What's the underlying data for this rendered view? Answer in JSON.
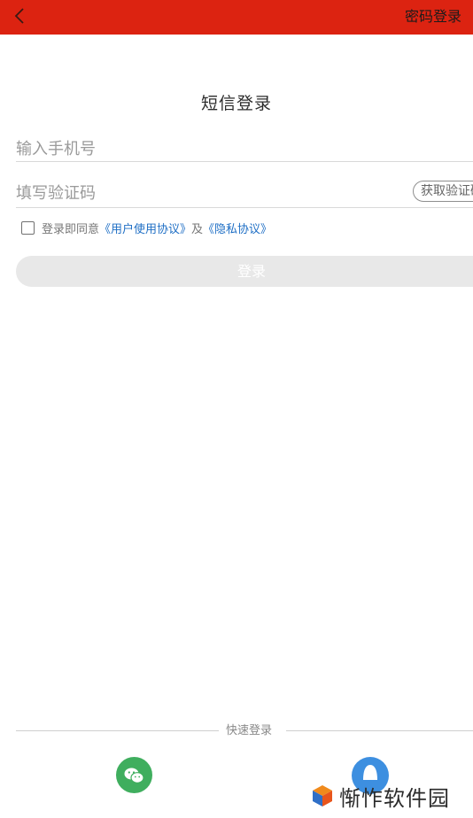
{
  "header": {
    "password_login_label": "密码登录"
  },
  "page": {
    "title": "短信登录"
  },
  "form": {
    "phone_placeholder": "输入手机号",
    "code_placeholder": "填写验证码",
    "get_code_label": "获取验证码"
  },
  "agreement": {
    "prefix": "登录即同意",
    "user_agreement": "《用户使用协议》",
    "and": "及",
    "privacy_policy": "《隐私协议》"
  },
  "login_button_label": "登录",
  "quick_login": {
    "label": "快速登录"
  },
  "watermark": {
    "text": "惭怍软件园"
  },
  "colors": {
    "topbar": "#dc2311",
    "link": "#1f6fc5",
    "wechat": "#3fae5e",
    "qq": "#3d8fe0"
  }
}
